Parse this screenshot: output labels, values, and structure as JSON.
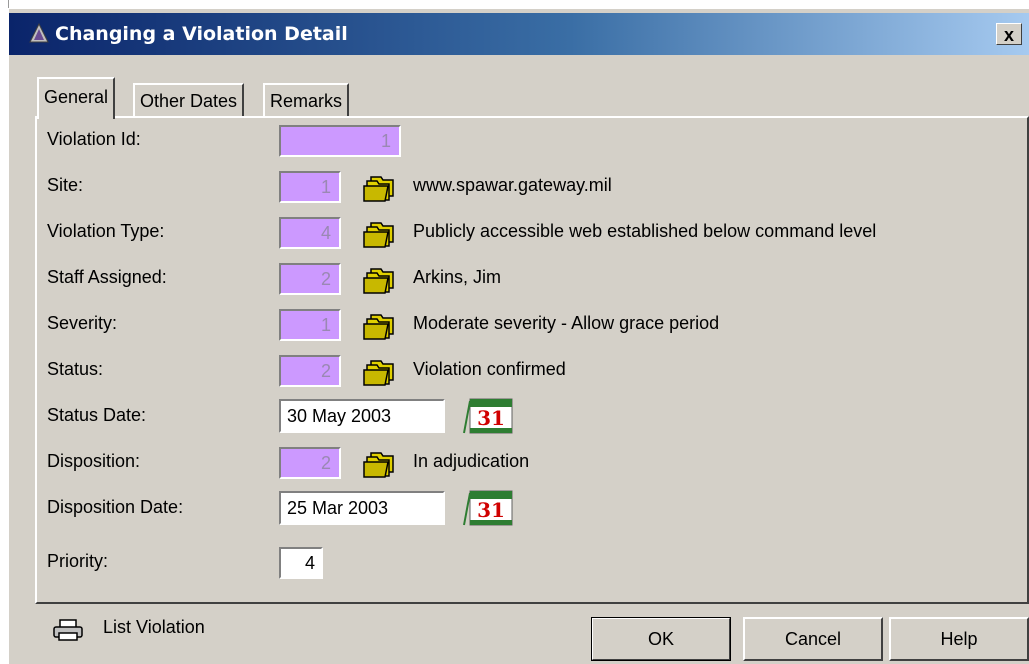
{
  "window": {
    "title": "Changing a Violation Detail",
    "close_glyph": "x"
  },
  "tabs": [
    {
      "label": "General",
      "active": true
    },
    {
      "label": "Other Dates",
      "active": false
    },
    {
      "label": "Remarks",
      "active": false
    }
  ],
  "fields": {
    "violation_id": {
      "label": "Violation Id:",
      "value": "1"
    },
    "site": {
      "label": "Site:",
      "code": "1",
      "description": "www.spawar.gateway.mil"
    },
    "violation_type": {
      "label": "Violation Type:",
      "code": "4",
      "description": "Publicly accessible web established below command level"
    },
    "staff_assigned": {
      "label": "Staff Assigned:",
      "code": "2",
      "description": "Arkins, Jim"
    },
    "severity": {
      "label": "Severity:",
      "code": "1",
      "description": "Moderate severity - Allow grace period"
    },
    "status": {
      "label": "Status:",
      "code": "2",
      "description": "Violation confirmed"
    },
    "status_date": {
      "label": "Status Date:",
      "value": "30 May 2003"
    },
    "disposition": {
      "label": "Disposition:",
      "code": "2",
      "description": "In adjudication"
    },
    "disposition_date": {
      "label": "Disposition Date:",
      "value": "25 Mar 2003"
    },
    "priority": {
      "label": "Priority:",
      "value": "4"
    }
  },
  "calendar_day": "31",
  "footer": {
    "list_violation": "List Violation",
    "ok": "OK",
    "cancel": "Cancel",
    "help": "Help"
  },
  "colors": {
    "code_field_bg": "#cc99ff",
    "title_start": "#0a246a",
    "title_end": "#a6caf0",
    "folder": "#e0d000"
  }
}
